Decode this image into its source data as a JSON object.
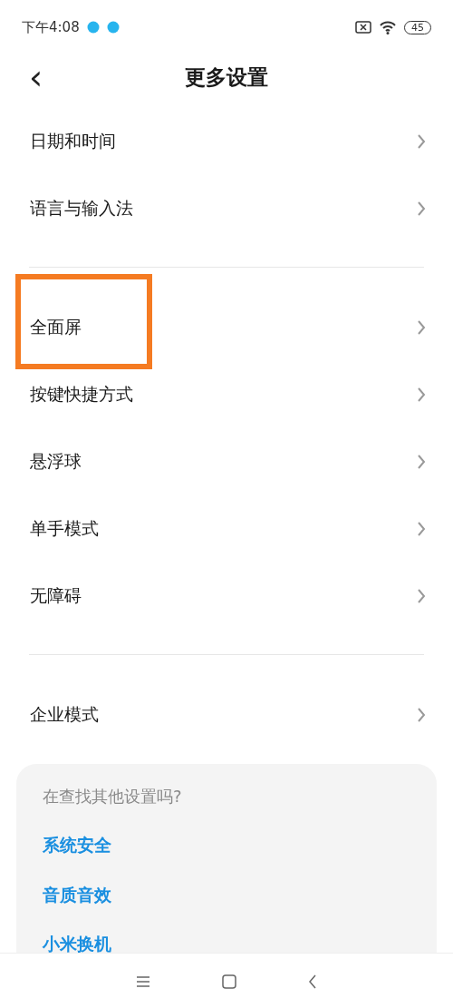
{
  "status_bar": {
    "time": "下午4:08",
    "battery": "45"
  },
  "header": {
    "back": "‹",
    "title": "更多设置"
  },
  "groups": [
    {
      "items": [
        {
          "label": "日期和时间",
          "highlighted": false
        },
        {
          "label": "语言与输入法",
          "highlighted": false
        }
      ]
    },
    {
      "items": [
        {
          "label": "全面屏",
          "highlighted": true
        },
        {
          "label": "按键快捷方式",
          "highlighted": false
        },
        {
          "label": "悬浮球",
          "highlighted": false
        },
        {
          "label": "单手模式",
          "highlighted": false
        },
        {
          "label": "无障碍",
          "highlighted": false
        }
      ]
    },
    {
      "items": [
        {
          "label": "企业模式",
          "highlighted": false
        }
      ]
    }
  ],
  "suggestions": {
    "title": "在查找其他设置吗?",
    "links": [
      "系统安全",
      "音质音效",
      "小米换机"
    ]
  }
}
